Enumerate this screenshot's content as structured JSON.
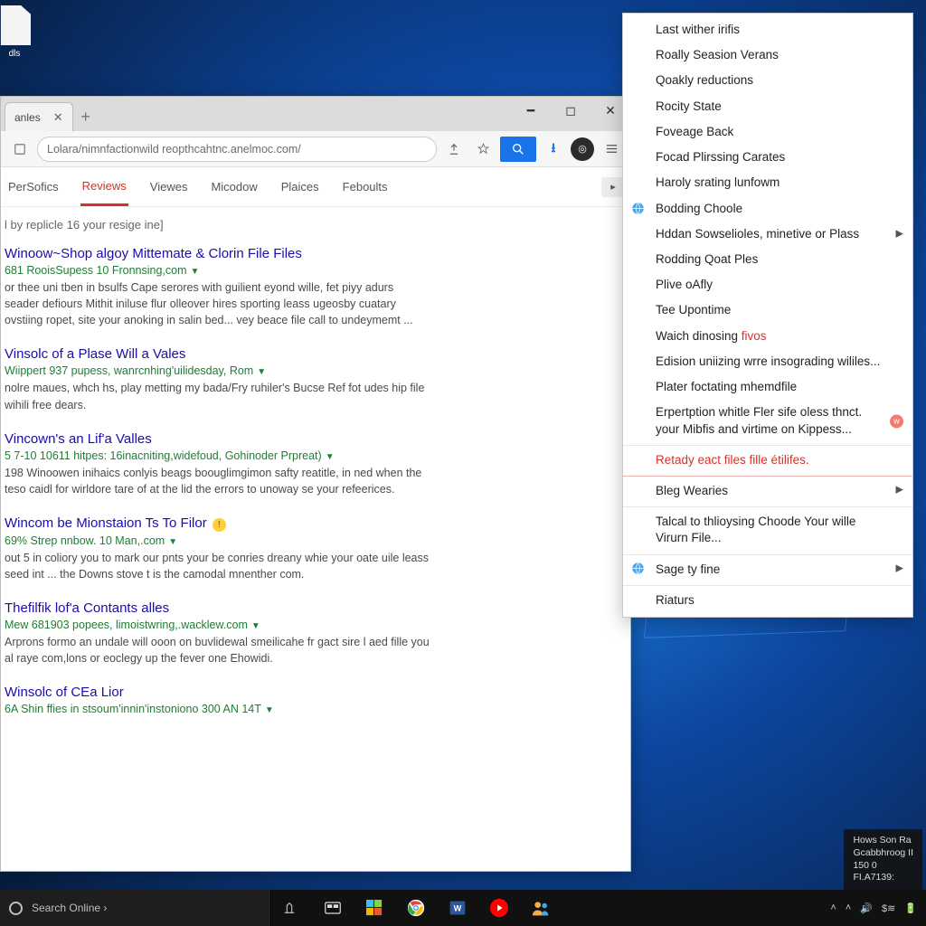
{
  "desktop_icon_label": "dls",
  "browser": {
    "tab_title": "anles",
    "url_display": "Lolara/nimnfactionwild reopthcahtnc.anelmoc.com/",
    "nav_items": [
      "PerSofics",
      "Reviews",
      "Viewes",
      "Micodow",
      "Plaices",
      "Feboults"
    ],
    "nav_active_index": 1,
    "hint_line": "l by replicle 16 your resige ine]",
    "results": [
      {
        "title": "Winoow~Shop algoy Mittemate & Clorin File Files",
        "cite": "681 RooisSupess 10 Fronnsing,com",
        "snippet": "or thee uni tben in bsulfs Cape serores with guilient eyond wille, fet piyy\nadurs seader defiours Mithit iniluse flur olleover hires sporting\nleass ugeosby cuatary ovstiing ropet, site your anoking in salin bed...\nvey beace file call to undeymemt ..."
      },
      {
        "title": "Vinsolc of a Plase Will a Vales",
        "cite": "Wiippert 937 pupess, wanrcnhing'uilidesday, Rom",
        "snippet": "nolre maues, whch hs, play metting my bada/Fry ruhiler's Bucse Ref fot\nudes hip file wihili free dears."
      },
      {
        "title": "Vincown's an Lif'a Valles",
        "cite": "5 7-10 10611 hitpes: 16inacniting,widefoud, Gohinoder Prpreat)",
        "snippet": "198 Winoowen inihaics conlyis beags boouglimgimon safty reatitle, in\nned when the teso caidl for wirldore tare of at the lid the errors to unoway\nse your refeerices."
      },
      {
        "title": "Wincom be Mionstaion Ts To Filor",
        "cite": "69% Strep nnbow. 10 Man,.com",
        "snippet": "out 5 in coliory you to mark our pnts your be conries dreany whie your\noate uile leass seed int ...\nthe Downs stove t is the camodal mnenther com.",
        "warn": true
      },
      {
        "title": "Thefilfik lof'a Contants alles",
        "cite": "Mew 681903 popees, limoistwring,.wacklew.com",
        "snippet": "Arprons formo an undale will ooon on buvlidewal smeilicahe fr gact sire\nl aed fille you al raye com,lons or eoclegy up the fever one Ehowidi."
      },
      {
        "title": "Winsolc of CEa Lior",
        "cite": "6A Shin ffies in stsoum'innin'instoniono 300 AN 14T",
        "snippet": ""
      }
    ]
  },
  "context_menu": {
    "items": [
      {
        "label": "Last wither irifis"
      },
      {
        "label": "Roally Seasion Verans"
      },
      {
        "label": "Qoakly reductions"
      },
      {
        "label": "Rocity State"
      },
      {
        "label": "Foveage Back"
      },
      {
        "label": "Focad Plirssing Carates"
      },
      {
        "label": "Haroly srating lunfowm"
      },
      {
        "label": "Bodding Choole",
        "icon": "globe"
      },
      {
        "label": "Hddan Sowselioles, minetive or Plass",
        "submenu": true
      },
      {
        "label": "Rodding Qoat Ples"
      },
      {
        "label": "Plive oAfly"
      },
      {
        "label": "Tee Upontime"
      },
      {
        "label_html": "Waich dinosing <span class='emword'>fivos</span>"
      },
      {
        "label": "Edision uniizing wrre insograding wililes..."
      },
      {
        "label": "Plater foctating mhemdfile"
      },
      {
        "label": "Erpertption whitle Fler sife oless thnct. your Mibfis and virtime on Kippess...",
        "badge": "w"
      },
      {
        "label": "Retady eact files fille étilifes.",
        "redtext": true,
        "sep": true
      },
      {
        "label": "Bleg Wearies",
        "submenu": true,
        "sep_red": true
      },
      {
        "label": "Talcal to thlioysing Choode Your wille Virurn File...",
        "sep": true
      },
      {
        "label": "Sage ty fine",
        "icon": "globe",
        "submenu": true,
        "sep": true
      },
      {
        "label": "Riaturs",
        "sep": true
      }
    ]
  },
  "taskbar": {
    "search_placeholder": "Search Online ›",
    "tray_text": "$≋",
    "time_text": "",
    "sys_line1": "Hows Son Ra",
    "sys_line2": "Gcabbhroog II",
    "sys_line3": "150 0",
    "sys_line4": "FI.A7139:"
  }
}
